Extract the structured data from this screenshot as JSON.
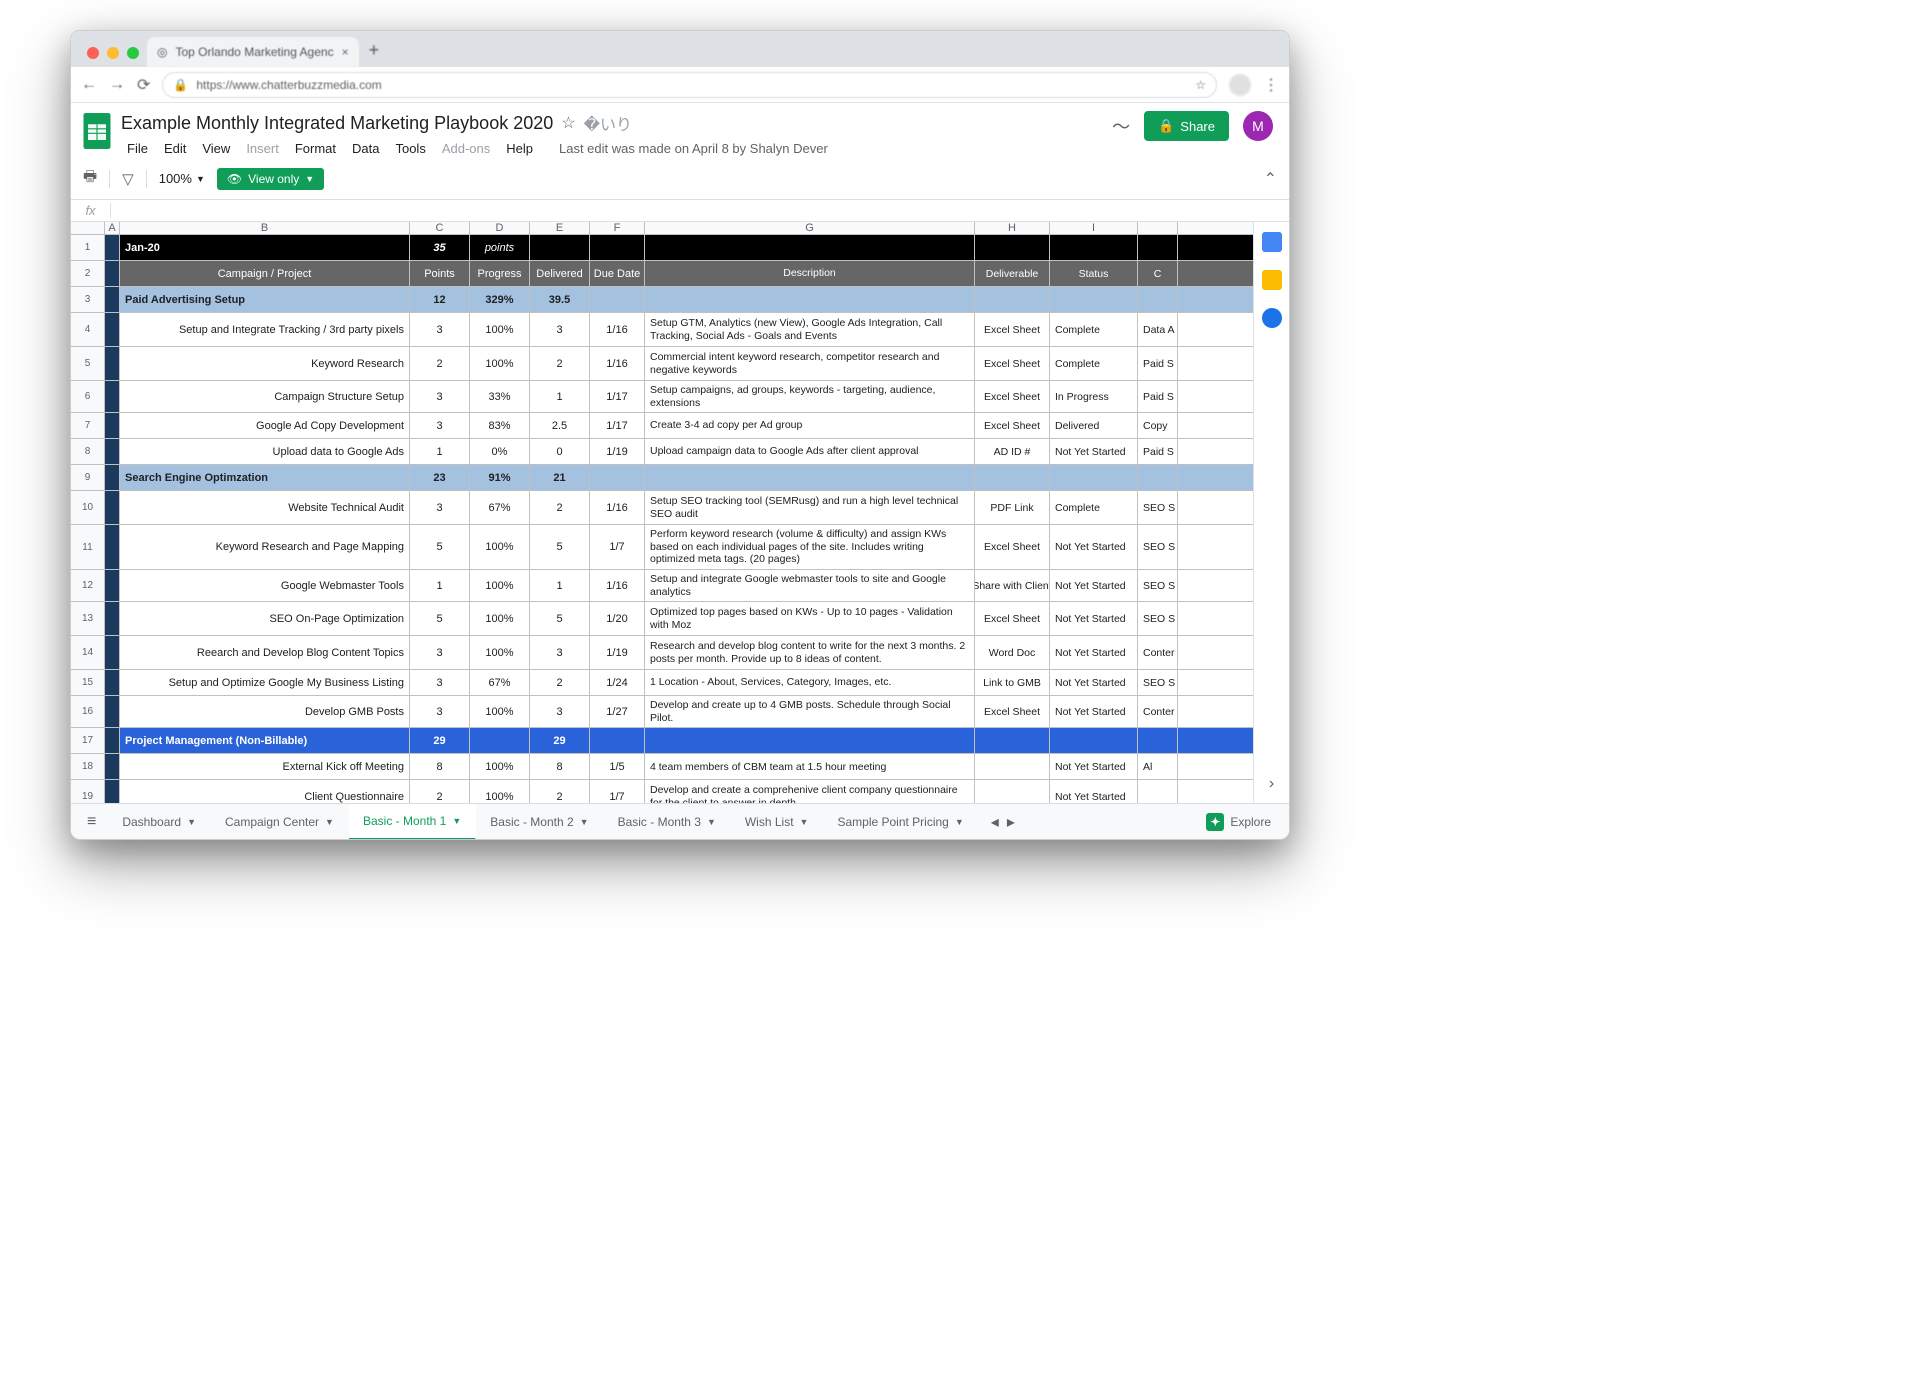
{
  "browser": {
    "tab_title": "Top Orlando Marketing Agenc",
    "url": "https://www.chatterbuzzmedia.com"
  },
  "doc": {
    "title": "Example Monthly Integrated Marketing Playbook 2020",
    "last_edit": "Last edit was made on April 8 by Shalyn Dever",
    "share_label": "Share",
    "avatar_letter": "M",
    "zoom": "100%",
    "view_only": "View only"
  },
  "menus": [
    "File",
    "Edit",
    "View",
    "Insert",
    "Format",
    "Data",
    "Tools",
    "Add-ons",
    "Help"
  ],
  "menus_disabled": [
    "Insert",
    "Add-ons"
  ],
  "col_letters": [
    "A",
    "B",
    "C",
    "D",
    "E",
    "F",
    "G",
    "H",
    "I"
  ],
  "header1": {
    "b": "Jan-20",
    "c": "35",
    "d": "points"
  },
  "header2": {
    "b": "Campaign / Project",
    "c": "Points",
    "d": "Progress",
    "e": "Delivered",
    "f": "Due Date",
    "g": "Description",
    "h": "Deliverable",
    "i": "Status",
    "j": "C"
  },
  "rows": [
    {
      "n": 3,
      "cls": "r-blue",
      "b": "Paid Advertising Setup",
      "c": "12",
      "d": "329%",
      "e": "39.5"
    },
    {
      "n": 4,
      "cls": "tall",
      "b": "Setup  and Integrate Tracking / 3rd party pixels",
      "c": "3",
      "d": "100%",
      "e": "3",
      "f": "1/16",
      "g": "Setup GTM, Analytics (new View), Google Ads Integration, Call Tracking, Social Ads - Goals and Events",
      "h": "Excel Sheet",
      "i": "Complete",
      "j": "Data A"
    },
    {
      "n": 5,
      "cls": "tall",
      "b": "Keyword Research",
      "c": "2",
      "d": "100%",
      "e": "2",
      "f": "1/16",
      "g": "Commercial intent keyword research, competitor research and negative keywords",
      "h": "Excel Sheet",
      "i": "Complete",
      "j": "Paid S"
    },
    {
      "n": 6,
      "b": "Campaign Structure Setup",
      "c": "3",
      "d": "33%",
      "e": "1",
      "f": "1/17",
      "g": "Setup campaigns, ad groups, keywords - targeting, audience, extensions",
      "h": "Excel Sheet",
      "i": "In Progress",
      "j": "Paid S"
    },
    {
      "n": 7,
      "b": "Google Ad Copy Development",
      "c": "3",
      "d": "83%",
      "e": "2.5",
      "f": "1/17",
      "g": "Create 3-4 ad copy per Ad group",
      "h": "Excel Sheet",
      "i": "Delivered",
      "j": "Copy"
    },
    {
      "n": 8,
      "b": "Upload data to Google Ads",
      "c": "1",
      "d": "0%",
      "e": "0",
      "f": "1/19",
      "g": "Upload campaign data to Google Ads after client approval",
      "h": "AD ID #",
      "i": "Not Yet Started",
      "j": "Paid S"
    },
    {
      "n": 9,
      "cls": "r-blue",
      "b": "Search Engine Optimzation",
      "c": "23",
      "d": "91%",
      "e": "21"
    },
    {
      "n": 10,
      "cls": "tall",
      "b": "Website Technical Audit",
      "c": "3",
      "d": "67%",
      "e": "2",
      "f": "1/16",
      "g": "Setup SEO tracking tool (SEMRusg) and run a high level technical SEO audit",
      "h": "PDF Link",
      "i": "Complete",
      "j": "SEO S"
    },
    {
      "n": 11,
      "cls": "tall",
      "b": "Keyword Research and Page Mapping",
      "c": "5",
      "d": "100%",
      "e": "5",
      "f": "1/7",
      "g": "Perform keyword research (volume & difficulty) and assign KWs based on each individual pages of the site. Includes writing optimized meta tags. (20 pages)",
      "h": "Excel Sheet",
      "i": "Not Yet Started",
      "j": "SEO S"
    },
    {
      "n": 12,
      "b": "Google Webmaster Tools",
      "c": "1",
      "d": "100%",
      "e": "1",
      "f": "1/16",
      "g": "Setup and integrate Google webmaster tools to site and Google analytics",
      "h": "Share with Client",
      "i": "Not Yet Started",
      "j": "SEO S"
    },
    {
      "n": 13,
      "cls": "tall",
      "b": "SEO On-Page Optimization",
      "c": "5",
      "d": "100%",
      "e": "5",
      "f": "1/20",
      "g": "Optimized top pages based on KWs - Up to 10 pages - Validation with Moz",
      "h": "Excel Sheet",
      "i": "Not Yet Started",
      "j": "SEO S"
    },
    {
      "n": 14,
      "cls": "tall",
      "b": "Reearch and Develop Blog Content Topics",
      "c": "3",
      "d": "100%",
      "e": "3",
      "f": "1/19",
      "g": "Research and develop blog content to write for the next 3 months. 2 posts per month. Provide up to 8 ideas of content.",
      "h": "Word Doc",
      "i": "Not Yet Started",
      "j": "Conter"
    },
    {
      "n": 15,
      "b": "Setup and Optimize Google My Business Listing",
      "c": "3",
      "d": "67%",
      "e": "2",
      "f": "1/24",
      "g": "1 Location - About, Services, Category, Images, etc.",
      "h": "Link to GMB",
      "i": "Not Yet Started",
      "j": "SEO S"
    },
    {
      "n": 16,
      "b": "Develop GMB Posts",
      "c": "3",
      "d": "100%",
      "e": "3",
      "f": "1/27",
      "g": "Develop and create up to 4 GMB posts. Schedule through Social Pilot.",
      "h": "Excel Sheet",
      "i": "Not Yet Started",
      "j": "Conter"
    },
    {
      "n": 17,
      "cls": "r-royal",
      "b": "Project Management (Non-Billable)",
      "c": "29",
      "e": "29"
    },
    {
      "n": 18,
      "b": "External Kick off Meeting",
      "c": "8",
      "d": "100%",
      "e": "8",
      "f": "1/5",
      "g": "4 team members of CBM team at 1.5 hour meeting",
      "i": "Not Yet Started",
      "j": "Al"
    },
    {
      "n": 19,
      "cls": "tall",
      "b": "Client Questionnaire",
      "c": "2",
      "d": "100%",
      "e": "2",
      "f": "1/7",
      "g": "Develop and create a comprehenive client company questionnaire for the client to answer in depth",
      "i": "Not Yet Started"
    }
  ],
  "sheets": [
    {
      "name": "Dashboard"
    },
    {
      "name": "Campaign Center"
    },
    {
      "name": "Basic - Month 1",
      "active": true
    },
    {
      "name": "Basic - Month 2"
    },
    {
      "name": "Basic - Month 3"
    },
    {
      "name": "Wish List"
    },
    {
      "name": "Sample Point Pricing"
    }
  ],
  "explore_label": "Explore"
}
